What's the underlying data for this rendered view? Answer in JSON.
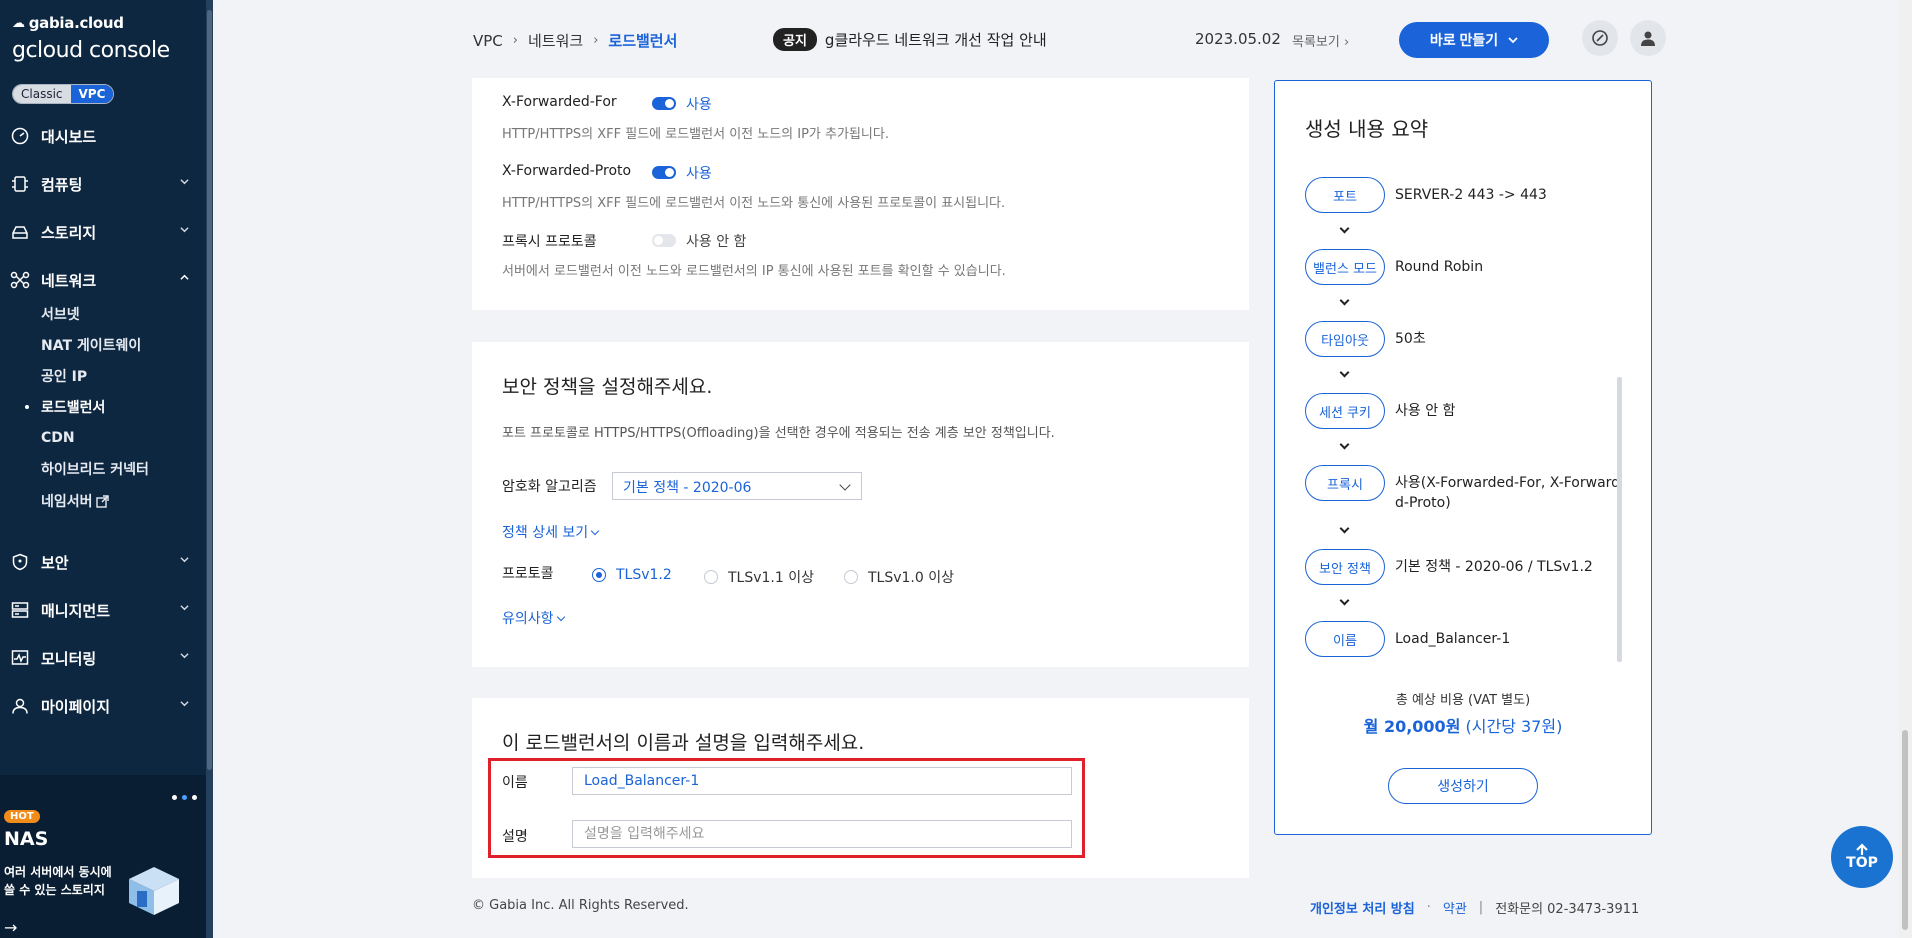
{
  "sidebar": {
    "brand_top": "gabia.cloud",
    "brand_main": "gcloud console",
    "mode_classic": "Classic",
    "mode_vpc": "VPC",
    "nav": [
      {
        "label": "대시보드",
        "icon": "dashboard-icon"
      },
      {
        "label": "컴퓨팅",
        "icon": "chip-icon"
      },
      {
        "label": "스토리지",
        "icon": "storage-icon"
      },
      {
        "label": "네트워크",
        "icon": "network-icon"
      },
      {
        "label": "보안",
        "icon": "shield-icon"
      },
      {
        "label": "매니지먼트",
        "icon": "management-icon"
      },
      {
        "label": "모니터링",
        "icon": "monitoring-icon"
      },
      {
        "label": "마이페이지",
        "icon": "user-icon"
      }
    ],
    "network_sub": [
      "서브넷",
      "NAT 게이트웨이",
      "공인 IP",
      "로드밸런서",
      "CDN",
      "하이브리드 커넥터",
      "네임서버"
    ],
    "promo": {
      "hot": "HOT",
      "title": "NAS",
      "desc": "여러 서버에서 동시에 쓸 수 있는 스토리지"
    }
  },
  "header": {
    "breadcrumb": [
      "VPC",
      "네트워크",
      "로드밸런서"
    ],
    "notice_badge": "공지",
    "notice_text": "g클라우드 네트워크 개선 작업 안내",
    "notice_date": "2023.05.02",
    "notice_list": "목록보기",
    "create_now": "바로 만들기"
  },
  "proxy_section": {
    "xff_label": "X-Forwarded-For",
    "xff_state": "사용",
    "xff_desc": "HTTP/HTTPS의 XFF 필드에 로드밸런서 이전 노드의 IP가 추가됩니다.",
    "xfp_label": "X-Forwarded-Proto",
    "xfp_state": "사용",
    "xfp_desc": "HTTP/HTTPS의 XFF 필드에 로드밸런서 이전 노드와 통신에 사용된 프로토콜이 표시됩니다.",
    "pp_label": "프록시 프로토콜",
    "pp_state": "사용 안 함",
    "pp_desc": "서버에서 로드밸런서 이전 노드와 로드밸런서의 IP 통신에 사용된 포트를 확인할 수 있습니다."
  },
  "security_section": {
    "title": "보안 정책을 설정해주세요.",
    "desc": "포트 프로토콜로 HTTPS/HTTPS(Offloading)을 선택한 경우에 적용되는 전송 계층 보안 정책입니다.",
    "cipher_label": "암호화 알고리즘",
    "cipher_value": "기본 정책 - 2020-06",
    "policy_detail": "정책 상세 보기",
    "protocol_label": "프로토콜",
    "protocols": [
      "TLSv1.2",
      "TLSv1.1 이상",
      "TLSv1.0 이상"
    ],
    "selected_protocol": "TLSv1.2",
    "notes": "유의사항"
  },
  "name_section": {
    "title": "이 로드밸런서의 이름과 설명을 입력해주세요.",
    "name_label": "이름",
    "name_value": "Load_Balancer-1",
    "desc_label": "설명",
    "desc_placeholder": "설명을 입력해주세요"
  },
  "summary": {
    "title": "생성 내용 요약",
    "steps": [
      {
        "pill": "포트",
        "value": "SERVER-2 443 -> 443"
      },
      {
        "pill": "밸런스 모드",
        "value": "Round Robin"
      },
      {
        "pill": "타임아웃",
        "value": "50초"
      },
      {
        "pill": "세션 쿠키",
        "value": "사용 안 함"
      },
      {
        "pill": "프록시",
        "value": "사용(X-Forwarded-For, X-Forwarde",
        "value2": "d-Proto)"
      },
      {
        "pill": "보안 정책",
        "value": "기본 정책 - 2020-06 / TLSv1.2"
      },
      {
        "pill": "이름",
        "value": "Load_Balancer-1"
      }
    ],
    "total_label": "총 예상 비용 (VAT 별도)",
    "total_main": "월 20,000원",
    "total_sub": "(시간당 37원)",
    "create_button": "생성하기"
  },
  "footer": {
    "copyright": "© Gabia Inc. All Rights Reserved.",
    "privacy": "개인정보 처리 방침",
    "dot": "·",
    "terms": "약관",
    "bar": "|",
    "phone": "전화문의  02-3473-3911"
  },
  "top_button": "TOP",
  "colors": {
    "sidebar_bg": "#0e2740",
    "accent": "#1a63d8",
    "highlight": "#e0202a"
  }
}
